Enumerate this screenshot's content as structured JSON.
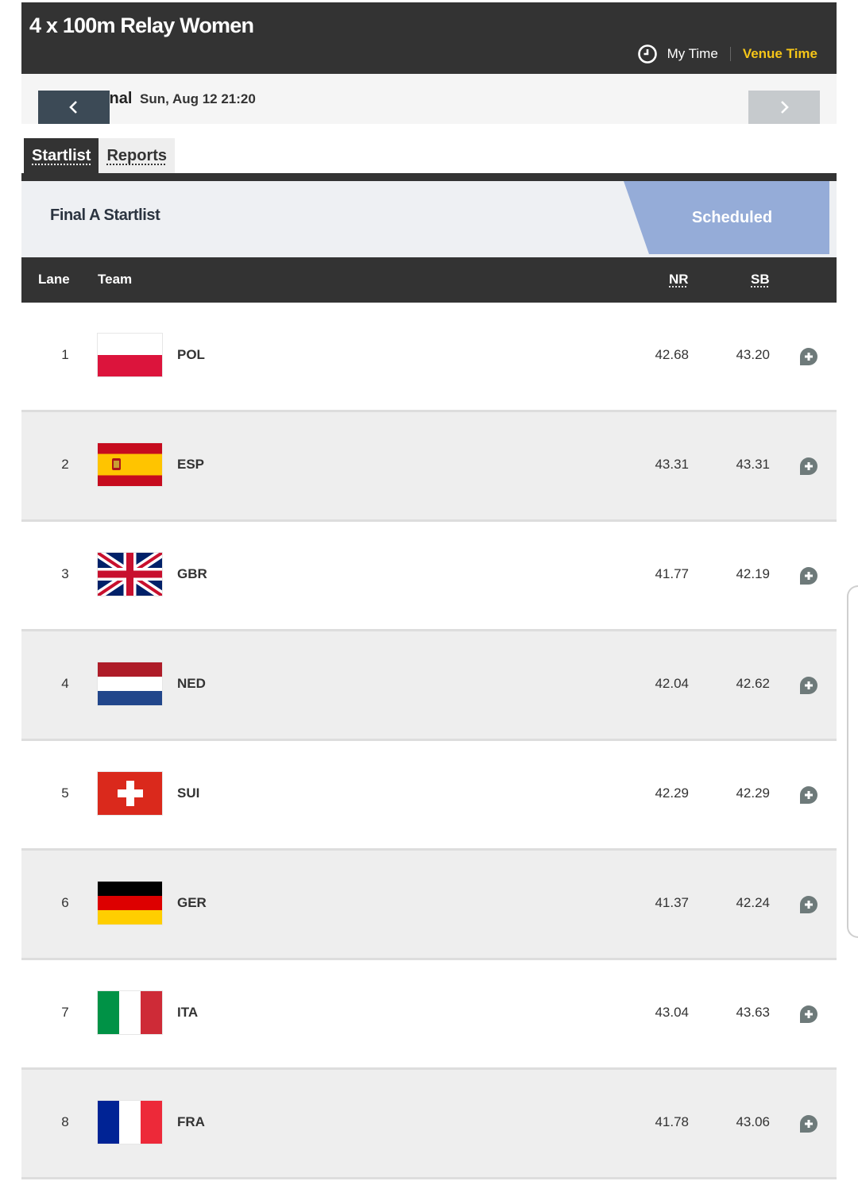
{
  "header": {
    "title": "4 x 100m Relay Women",
    "my_time_label": "My Time",
    "venue_time_label": "Venue Time",
    "clock_icon": "clock-icon",
    "accent_color": "#f5c518"
  },
  "round": {
    "label": "inal",
    "date": "Sun, Aug 12 21:20",
    "prev_icon": "chevron-left-icon",
    "next_icon": "chevron-right-icon"
  },
  "tabs": [
    {
      "label": "Startlist",
      "active": true
    },
    {
      "label": "Reports",
      "active": false
    }
  ],
  "section": {
    "title": "Final A Startlist",
    "status": "Scheduled",
    "status_color": "#95acd8"
  },
  "table": {
    "columns": {
      "lane": "Lane",
      "team": "Team",
      "nr": "NR",
      "sb": "SB"
    },
    "rows": [
      {
        "lane": "1",
        "team": "POL",
        "nr": "42.68",
        "sb": "43.20",
        "flag": "poland-flag-icon"
      },
      {
        "lane": "2",
        "team": "ESP",
        "nr": "43.31",
        "sb": "43.31",
        "flag": "spain-flag-icon"
      },
      {
        "lane": "3",
        "team": "GBR",
        "nr": "41.77",
        "sb": "42.19",
        "flag": "great-britain-flag-icon"
      },
      {
        "lane": "4",
        "team": "NED",
        "nr": "42.04",
        "sb": "42.62",
        "flag": "netherlands-flag-icon"
      },
      {
        "lane": "5",
        "team": "SUI",
        "nr": "42.29",
        "sb": "42.29",
        "flag": "switzerland-flag-icon"
      },
      {
        "lane": "6",
        "team": "GER",
        "nr": "41.37",
        "sb": "42.24",
        "flag": "germany-flag-icon"
      },
      {
        "lane": "7",
        "team": "ITA",
        "nr": "43.04",
        "sb": "43.63",
        "flag": "italy-flag-icon"
      },
      {
        "lane": "8",
        "team": "FRA",
        "nr": "41.78",
        "sb": "43.06",
        "flag": "france-flag-icon"
      }
    ],
    "expand_icon": "plus-bubble-icon"
  }
}
